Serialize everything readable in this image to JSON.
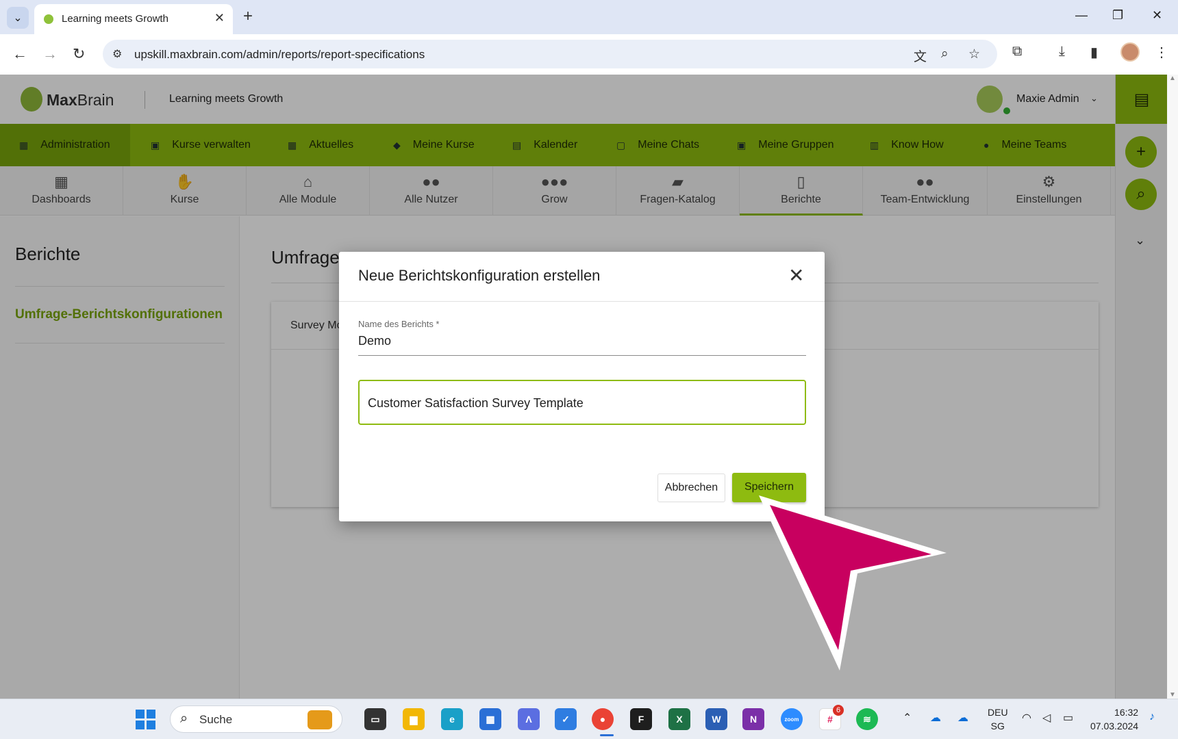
{
  "browser": {
    "tab_title": "Learning meets Growth",
    "url": "upskill.maxbrain.com/admin/reports/report-specifications"
  },
  "app": {
    "logo_bold": "Max",
    "logo_light": "Brain",
    "tagline": "Learning meets Growth",
    "user_name": "Maxie Admin"
  },
  "main_nav": [
    {
      "label": "Administration",
      "icon": "dashboard-icon"
    },
    {
      "label": "Kurse verwalten",
      "icon": "folder-icon"
    },
    {
      "label": "Aktuelles",
      "icon": "grid-icon"
    },
    {
      "label": "Meine Kurse",
      "icon": "graduation-cap-icon"
    },
    {
      "label": "Kalender",
      "icon": "calendar-icon"
    },
    {
      "label": "Meine Chats",
      "icon": "chat-icon"
    },
    {
      "label": "Meine Gruppen",
      "icon": "group-folder-icon"
    },
    {
      "label": "Know How",
      "icon": "book-icon"
    },
    {
      "label": "Meine Teams",
      "icon": "team-icon"
    }
  ],
  "sub_nav": [
    {
      "label": "Dashboards",
      "icon": "dashboard-icon"
    },
    {
      "label": "Kurse",
      "icon": "course-icon"
    },
    {
      "label": "Alle Module",
      "icon": "institution-icon"
    },
    {
      "label": "Alle Nutzer",
      "icon": "users-icon"
    },
    {
      "label": "Grow",
      "icon": "group-icon"
    },
    {
      "label": "Fragen-Katalog",
      "icon": "chat-bubbles-icon"
    },
    {
      "label": "Berichte",
      "icon": "report-icon"
    },
    {
      "label": "Team-Entwicklung",
      "icon": "team-icon"
    },
    {
      "label": "Einstellungen",
      "icon": "gears-icon"
    }
  ],
  "left_panel": {
    "title": "Berichte",
    "link": "Umfrage-Berichtskonfigurationen"
  },
  "content": {
    "title": "Umfrage",
    "column_header": "Survey Mo"
  },
  "dialog": {
    "title": "Neue Berichtskonfiguration erstellen",
    "field_label": "Name des Berichts *",
    "field_value": "Demo",
    "select_value": "Customer Satisfaction Survey Template",
    "cancel_label": "Abbrechen",
    "save_label": "Speichern"
  },
  "taskbar": {
    "search_label": "Suche",
    "lang": "DEU",
    "region": "SG",
    "time": "16:32",
    "date": "07.03.2024",
    "slack_badge": "6"
  },
  "colors": {
    "accent": "#8ebb10",
    "accent_dark": "#7aa60b",
    "pointer": "#c8005f"
  }
}
